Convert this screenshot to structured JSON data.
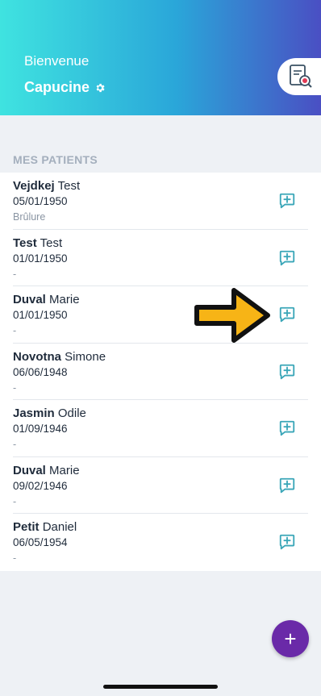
{
  "header": {
    "welcome": "Bienvenue",
    "username": "Capucine"
  },
  "section": {
    "title": "MES PATIENTS"
  },
  "patients": [
    {
      "last": "Vejdkej",
      "first": "Test",
      "dob": "05/01/1950",
      "note": "Brûlure"
    },
    {
      "last": "Test",
      "first": "Test",
      "dob": "01/01/1950",
      "note": "-"
    },
    {
      "last": "Duval",
      "first": "Marie",
      "dob": "01/01/1950",
      "note": "-"
    },
    {
      "last": "Novotna",
      "first": "Simone",
      "dob": "06/06/1948",
      "note": "-"
    },
    {
      "last": "Jasmin",
      "first": "Odile",
      "dob": "01/09/1946",
      "note": "-"
    },
    {
      "last": "Duval",
      "first": "Marie",
      "dob": "09/02/1946",
      "note": "-"
    },
    {
      "last": "Petit",
      "first": "Daniel",
      "dob": "06/05/1954",
      "note": "-"
    }
  ],
  "fab": {
    "label": "+"
  },
  "colors": {
    "accent": "#3aa6b8",
    "fab": "#6a2aa8",
    "arrow": "#f7b416"
  },
  "icons": {
    "settings": "gear-icon",
    "document": "document-search-icon",
    "comment": "comment-add-icon"
  }
}
